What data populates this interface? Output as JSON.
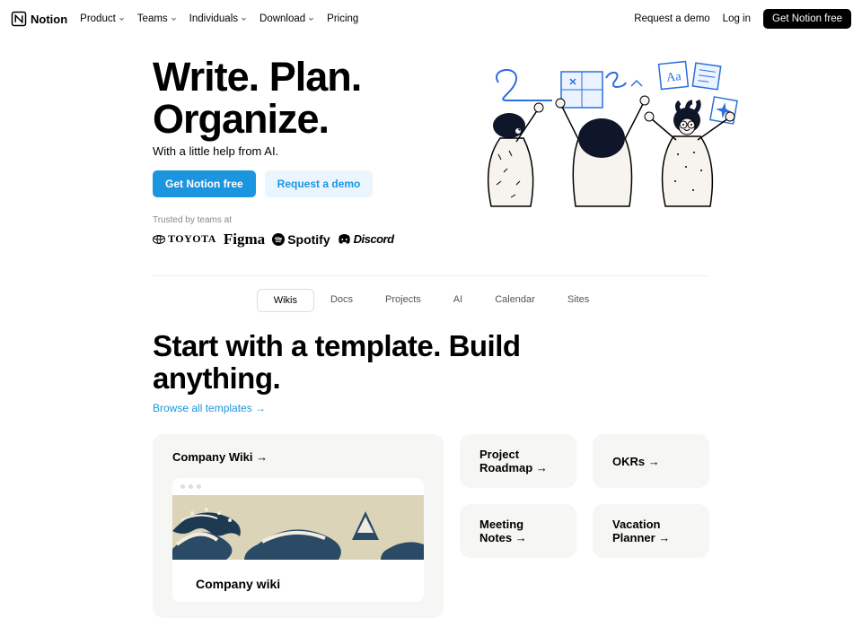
{
  "nav": {
    "brand": "Notion",
    "items": [
      {
        "label": "Product",
        "caret": true
      },
      {
        "label": "Teams",
        "caret": true
      },
      {
        "label": "Individuals",
        "caret": true
      },
      {
        "label": "Download",
        "caret": true
      },
      {
        "label": "Pricing",
        "caret": false
      }
    ],
    "right": {
      "demo": "Request a demo",
      "login": "Log in",
      "cta": "Get Notion free"
    }
  },
  "hero": {
    "line1": "Write. Plan.",
    "line2": "Organize.",
    "sub": "With a little help from AI.",
    "cta": "Get Notion free",
    "demo": "Request a demo"
  },
  "trust": {
    "label": "Trusted by teams at",
    "logos": [
      "TOYOTA",
      "Figma",
      "Spotify",
      "Discord"
    ]
  },
  "tabs": [
    "Wikis",
    "Docs",
    "Projects",
    "AI",
    "Calendar",
    "Sites"
  ],
  "templates": {
    "heading_l1": "Start with a template. Build",
    "heading_l2": "anything.",
    "link": "Browse all templates →",
    "cards": {
      "big": {
        "title": "Company Wiki →",
        "preview": "Company wiki"
      },
      "c1": "Project Roadmap →",
      "c2": "OKRs →",
      "c3": "Meeting Notes →",
      "c4": "Vacation Planner →"
    }
  }
}
